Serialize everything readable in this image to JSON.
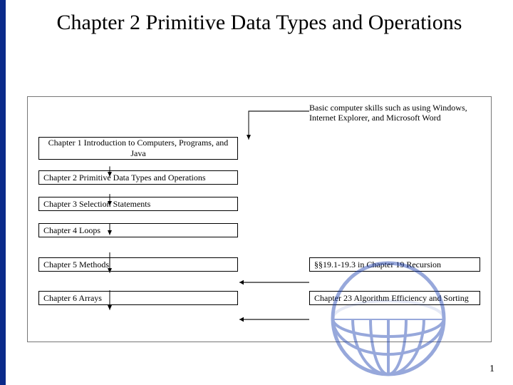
{
  "title": "Chapter 2 Primitive Data Types and Operations",
  "note": "Basic computer skills such as using Windows, Internet Explorer, and Microsoft Word",
  "chapters": {
    "c1": "Chapter 1 Introduction to Computers, Programs, and Java",
    "c2": "Chapter 2 Primitive Data Types and Operations",
    "c3": "Chapter 3 Selection Statements",
    "c4": "Chapter 4 Loops",
    "c5": "Chapter 5 Methods",
    "c6": "Chapter 6 Arrays"
  },
  "refs": {
    "r19": "§§19.1-19.3 in Chapter 19 Recursion",
    "r23": "Chapter 23 Algorithm Efficiency and Sorting"
  },
  "page": "1"
}
